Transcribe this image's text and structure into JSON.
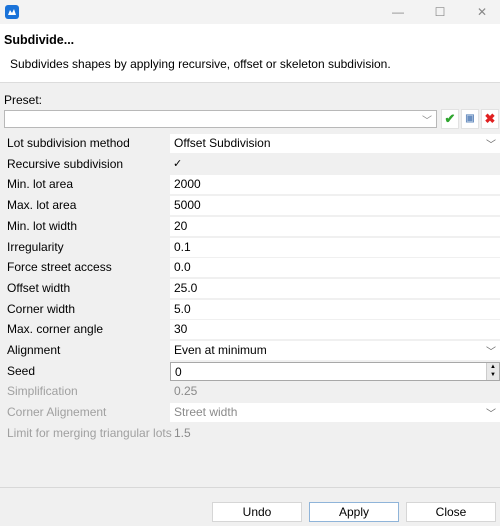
{
  "window": {
    "app_icon": "app-logo-icon",
    "controls": {
      "minimize": "—",
      "maximize": "☐",
      "close": "✕"
    }
  },
  "header": {
    "title": "Subdivide...",
    "description": "Subdivides shapes by applying recursive, offset or skeleton subdivision."
  },
  "preset": {
    "label": "Preset:",
    "value": "",
    "chevron": "﹀",
    "apply_icon": "✔",
    "save_icon": "💾",
    "delete_icon": "✖"
  },
  "params": [
    {
      "label": "Lot subdivision method",
      "value": "Offset Subdivision",
      "type": "dropdown",
      "disabled": false
    },
    {
      "label": "Recursive subdivision",
      "value": "✓",
      "type": "checkbox",
      "checked": true,
      "disabled": false
    },
    {
      "label": "Min. lot area",
      "value": "2000",
      "type": "text",
      "disabled": false
    },
    {
      "label": "Max. lot area",
      "value": "5000",
      "type": "text",
      "disabled": false
    },
    {
      "label": "Min. lot width",
      "value": "20",
      "type": "text",
      "disabled": false
    },
    {
      "label": "Irregularity",
      "value": "0.1",
      "type": "text",
      "disabled": false
    },
    {
      "label": "Force street access",
      "value": "0.0",
      "type": "text",
      "disabled": false
    },
    {
      "label": "Offset width",
      "value": "25.0",
      "type": "text",
      "disabled": false
    },
    {
      "label": "Corner width",
      "value": "5.0",
      "type": "text",
      "disabled": false
    },
    {
      "label": "Max. corner angle",
      "value": "30",
      "type": "text",
      "disabled": false
    },
    {
      "label": "Alignment",
      "value": "Even at minimum",
      "type": "dropdown",
      "disabled": false
    },
    {
      "label": "Seed",
      "value": "0",
      "type": "spinner",
      "disabled": false
    },
    {
      "label": "Simplification",
      "value": "0.25",
      "type": "text",
      "disabled": true
    },
    {
      "label": "Corner Alignement",
      "value": "Street width",
      "type": "dropdown",
      "disabled": true
    },
    {
      "label": "Limit for merging triangular lots",
      "value": "1.5",
      "type": "text",
      "disabled": true
    }
  ],
  "chevron": "﹀",
  "spin_up": "▲",
  "spin_down": "▼",
  "buttons": {
    "undo": "Undo",
    "apply": "Apply",
    "close": "Close"
  }
}
